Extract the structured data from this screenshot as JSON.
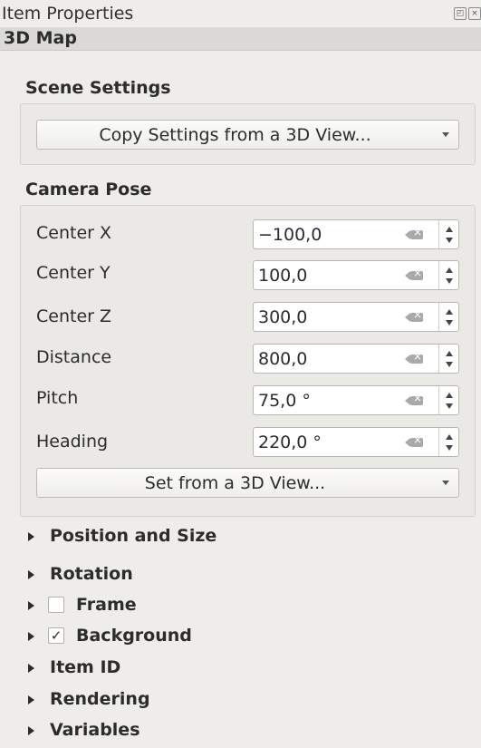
{
  "window": {
    "title": "Item Properties"
  },
  "header": {
    "item_type": "3D Map"
  },
  "scene_settings": {
    "title": "Scene Settings",
    "copy_button_label": "Copy Settings from a 3D View..."
  },
  "camera_pose": {
    "title": "Camera Pose",
    "fields": [
      {
        "label": "Center X",
        "value": "−100,0"
      },
      {
        "label": "Center Y",
        "value": "100,0"
      },
      {
        "label": "Center Z",
        "value": "300,0"
      },
      {
        "label": "Distance",
        "value": "800,0"
      },
      {
        "label": "Pitch",
        "value": "75,0 °"
      },
      {
        "label": "Heading",
        "value": "220,0 °"
      }
    ],
    "set_button_label": "Set from a 3D View..."
  },
  "collapsed_sections": [
    {
      "label": "Position and Size"
    },
    {
      "label": "Rotation"
    },
    {
      "label": "Frame",
      "checked": false
    },
    {
      "label": "Background",
      "checked": true
    },
    {
      "label": "Item ID"
    },
    {
      "label": "Rendering"
    },
    {
      "label": "Variables"
    }
  ],
  "icons": {
    "float": "float-icon",
    "close": "close-icon",
    "clear": "clear-icon",
    "dropdown": "dropdown-arrow-icon",
    "spin_up": "spin-up-icon",
    "spin_down": "spin-down-icon",
    "expand": "expand-triangle-icon",
    "check": "checkmark-icon"
  },
  "checkbox_mark": "✓"
}
